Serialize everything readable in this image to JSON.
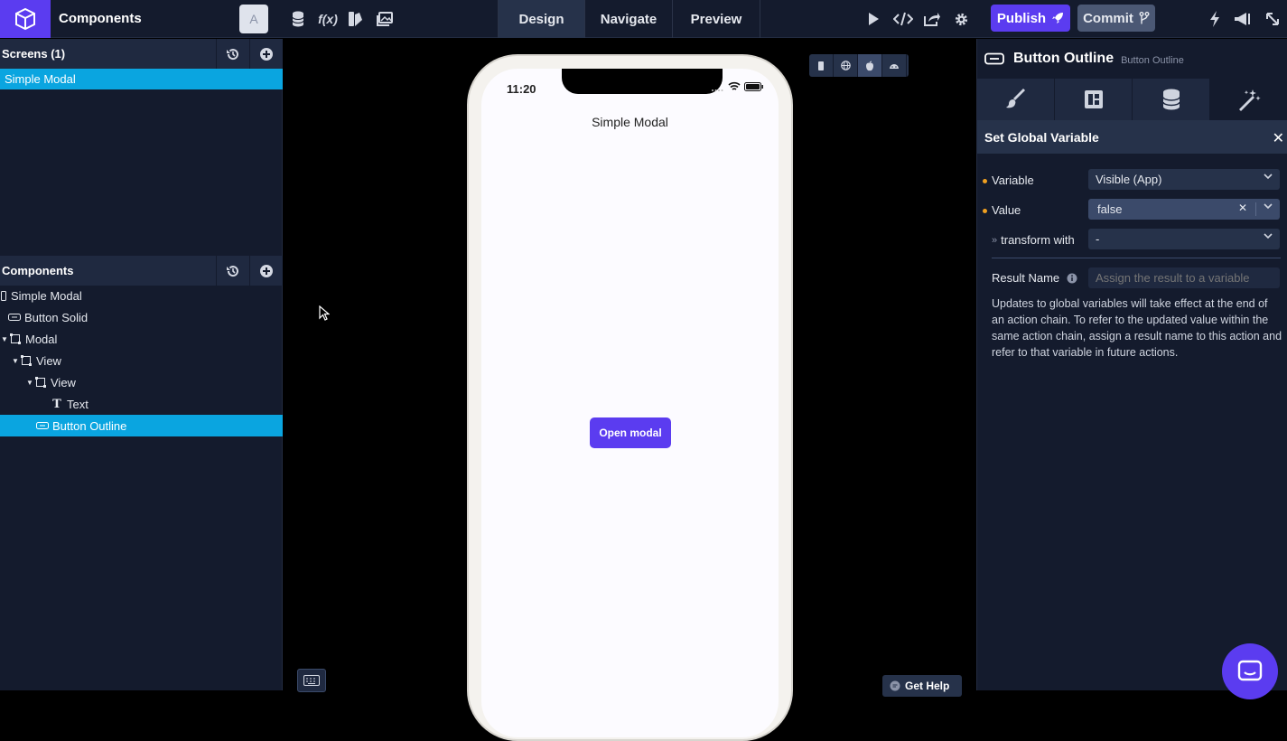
{
  "topbar": {
    "app_title": "Components",
    "avatar_letter": "A",
    "tools": [
      "database-icon",
      "function-icon",
      "style-icon",
      "media-icon"
    ],
    "modes": [
      {
        "label": "Design",
        "active": true
      },
      {
        "label": "Navigate",
        "active": false
      },
      {
        "label": "Preview",
        "active": false
      }
    ],
    "publish_label": "Publish",
    "commit_label": "Commit"
  },
  "screens": {
    "header": "Screens (1)",
    "items": [
      "Simple Modal"
    ]
  },
  "components": {
    "header": "Components",
    "tree": [
      {
        "label": "Simple Modal",
        "icon": "screen-icon",
        "depth": 0,
        "caret": false,
        "selected": false
      },
      {
        "label": "Button Solid",
        "icon": "button-icon",
        "depth": 1,
        "caret": false,
        "selected": false
      },
      {
        "label": "Modal",
        "icon": "view-icon",
        "depth": 0,
        "caret": true,
        "selected": false
      },
      {
        "label": "View",
        "icon": "view-icon",
        "depth": 1,
        "caret": true,
        "selected": false
      },
      {
        "label": "View",
        "icon": "view-icon",
        "depth": 2,
        "caret": true,
        "selected": false
      },
      {
        "label": "Text",
        "icon": "text-icon",
        "depth": 3,
        "caret": false,
        "selected": false
      },
      {
        "label": "Button Outline",
        "icon": "button-icon",
        "depth": 2,
        "caret": false,
        "selected": true
      }
    ]
  },
  "canvas": {
    "status_time": "11:20",
    "screen_title": "Simple Modal",
    "button_label": "Open modal",
    "help_label": "Get Help"
  },
  "inspector": {
    "component_name": "Button Outline",
    "component_type": "Button Outline",
    "action_title": "Set Global Variable",
    "variable_label": "Variable",
    "variable_value": "Visible (App)",
    "value_label": "Value",
    "value_value": "false",
    "transform_label": "transform with",
    "transform_value": "-",
    "result_label": "Result Name",
    "result_placeholder": "Assign the result to a variable",
    "help_text": "Updates to global variables will take effect at the end of an action chain. To refer to the updated value within the same action chain, assign a result name to this action and refer to that variable in future actions."
  },
  "colors": {
    "accent": "#5b3cf0",
    "selection": "#0aa5e0",
    "panel": "#141b2d"
  }
}
